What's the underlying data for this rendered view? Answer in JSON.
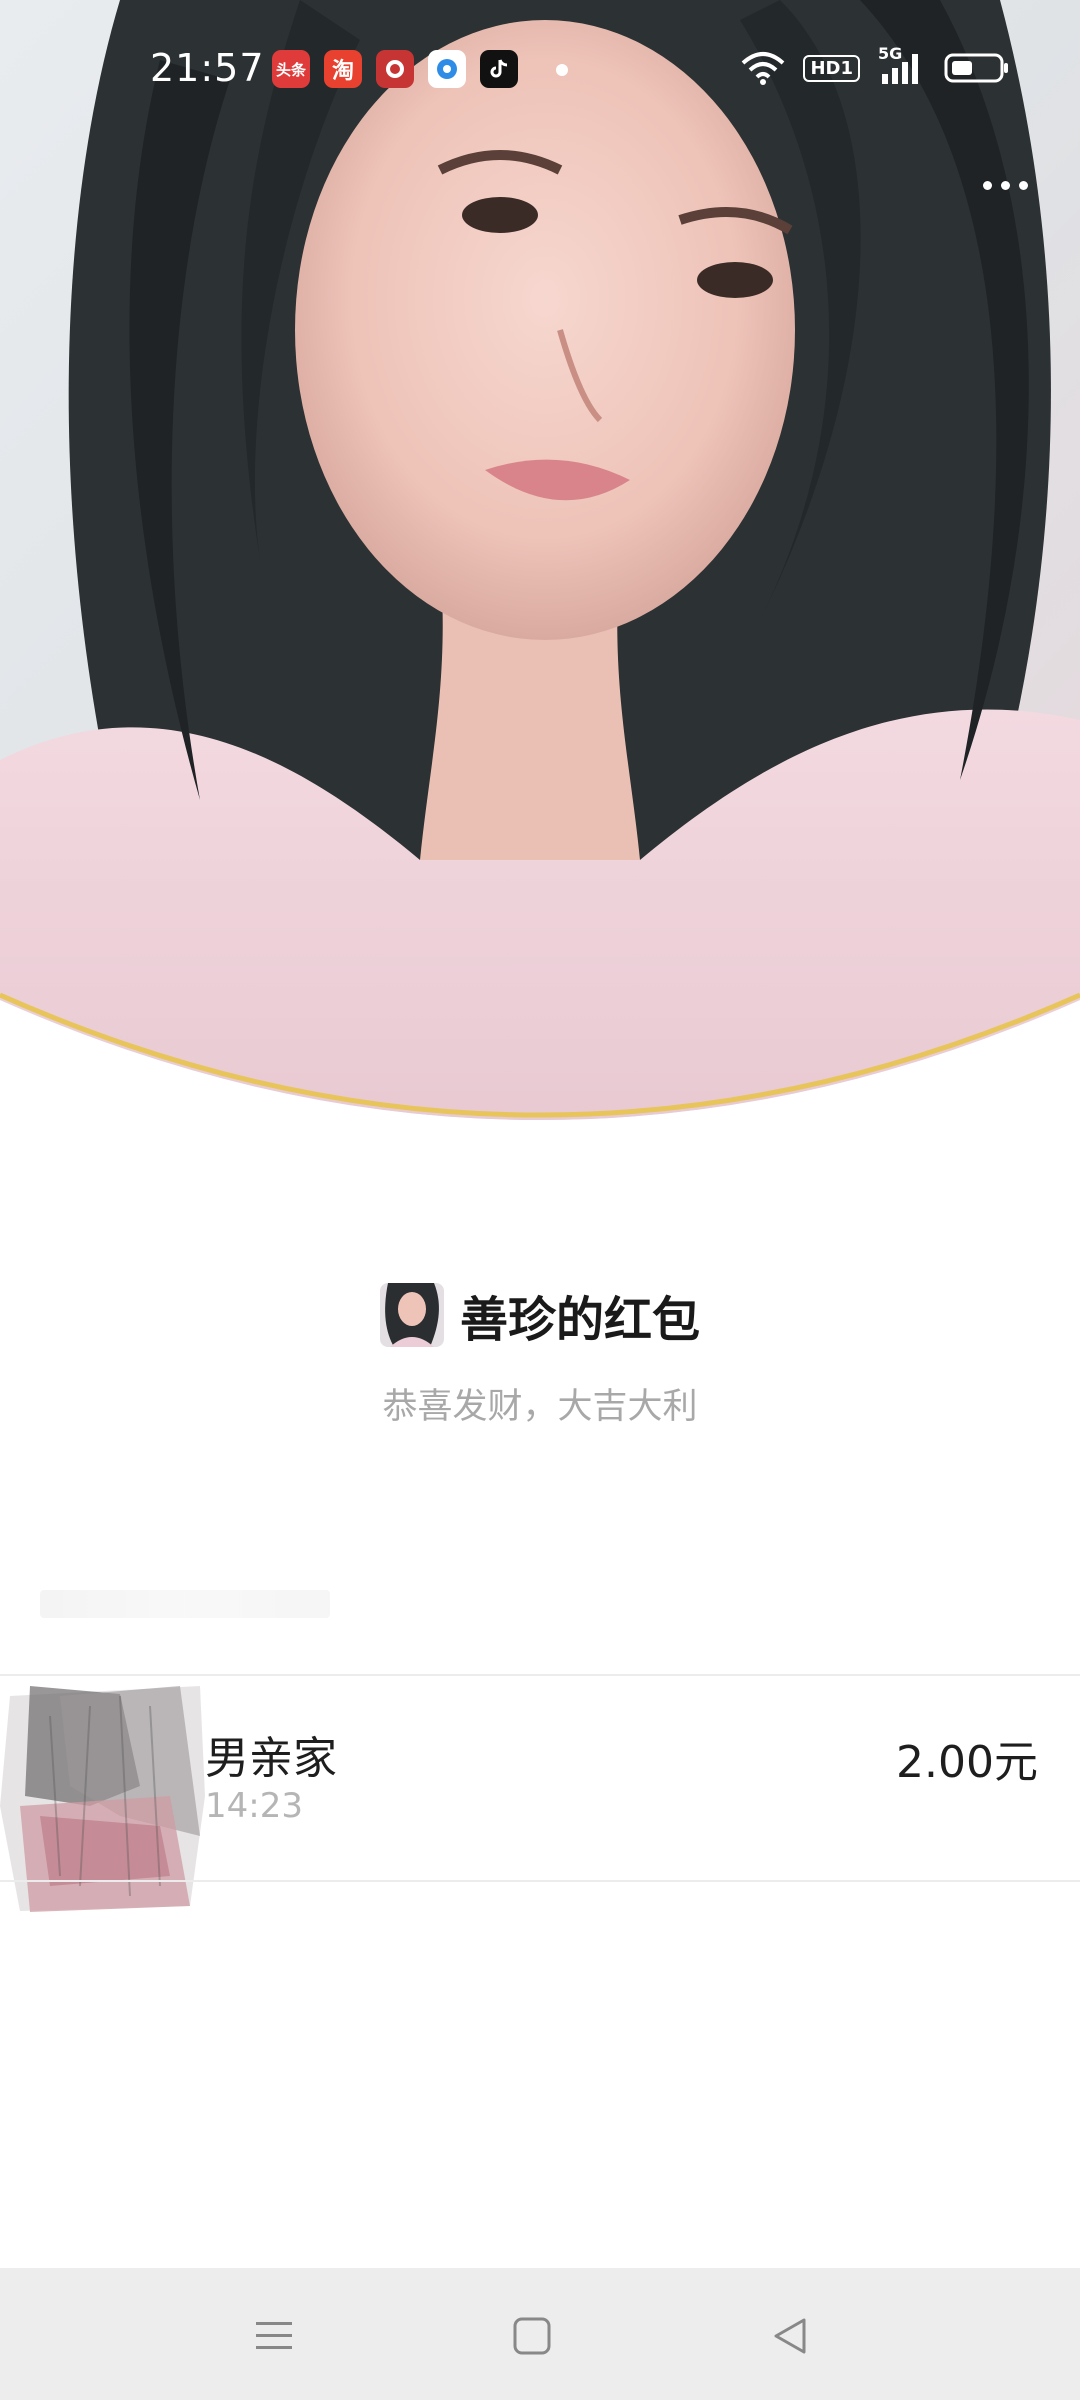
{
  "status_bar": {
    "time": "21:57",
    "notification_icons": [
      {
        "name": "toutiao-icon",
        "label": "头条",
        "color": "#e03b3b"
      },
      {
        "name": "taobao-icon",
        "label": "淘",
        "color": "#e8412f"
      },
      {
        "name": "bank-app-icon",
        "label": "",
        "color": "#c63434"
      },
      {
        "name": "news-app-icon",
        "label": "",
        "color": "#2f8ce6"
      },
      {
        "name": "tiktok-icon",
        "label": "",
        "color": "#111111"
      }
    ],
    "hd_label": "HD1",
    "network": "5G"
  },
  "header": {
    "more_icon": "more-dots-icon"
  },
  "packet": {
    "title": "善珍的红包",
    "blessing": "恭喜发财，大吉大利"
  },
  "receivers": [
    {
      "name": "男亲家",
      "time": "14:23",
      "amount": "2.00元"
    }
  ],
  "nav": {
    "menu_icon": "menu-icon",
    "home_icon": "home-square-icon",
    "back_icon": "back-triangle-icon"
  },
  "colors": {
    "hero_arc_border": "#e7c55a",
    "nav_background": "#ededed",
    "muted_text": "#a8a8a8"
  }
}
